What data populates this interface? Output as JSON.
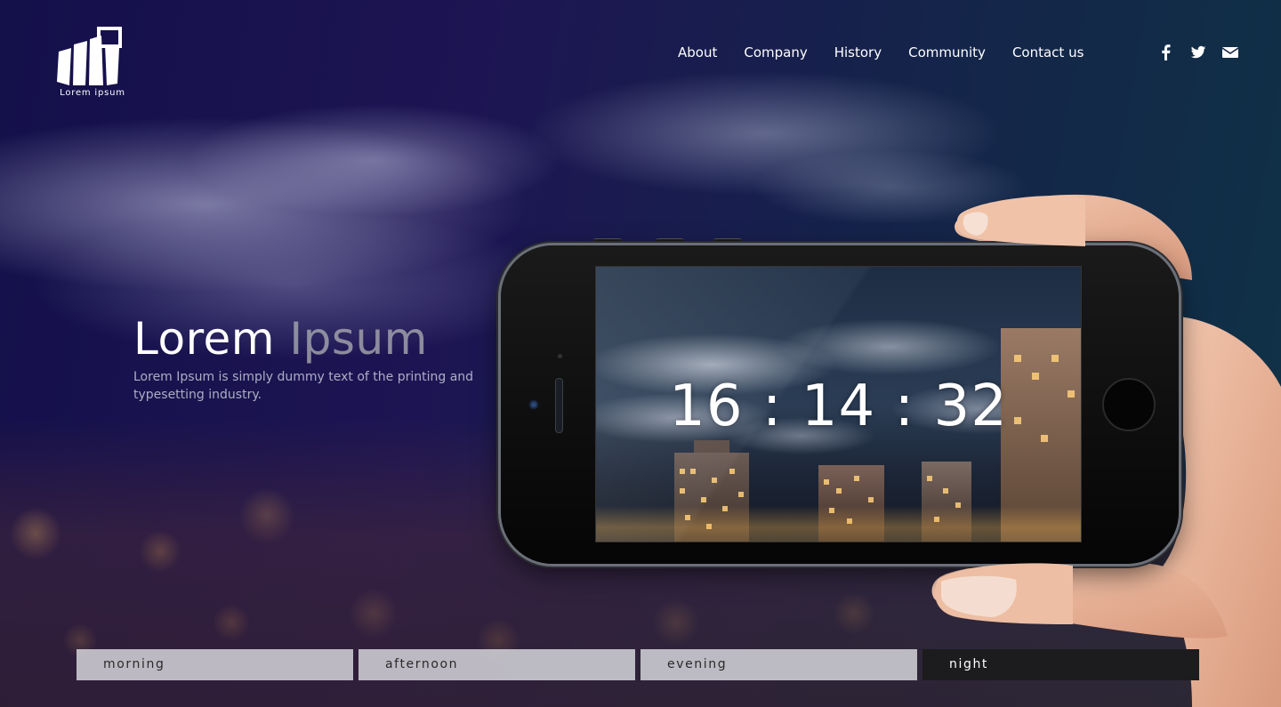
{
  "header": {
    "logo_text": "Lorem ipsum",
    "nav": [
      "About",
      "Company",
      "History",
      "Community",
      "Contact us"
    ],
    "social_icons": [
      "facebook-icon",
      "twitter-icon",
      "envelope-icon"
    ]
  },
  "hero": {
    "title_first": "Lorem",
    "title_second": "Ipsum",
    "subtitle": "Lorem Ipsum is simply dummy text of the printing and typesetting industry."
  },
  "clock": {
    "time": "16 : 14 : 32"
  },
  "tabs": {
    "items": [
      "morning",
      "afternoon",
      "evening",
      "night"
    ],
    "active": "night"
  },
  "colors": {
    "tab_inactive": "#dcdce1",
    "tab_active": "#1c1c1e",
    "background_top": "#14104a",
    "background_right": "#0f3346"
  }
}
